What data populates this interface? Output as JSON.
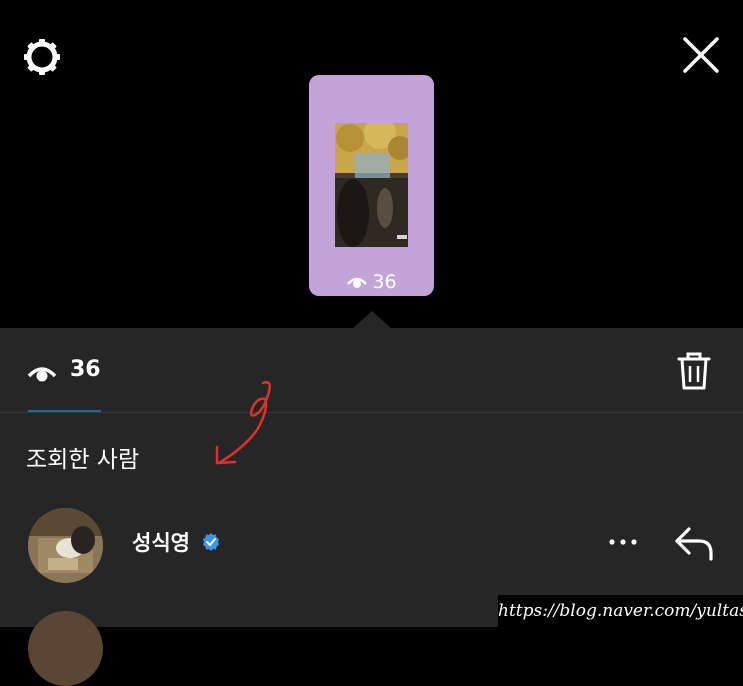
{
  "header": {
    "settings_icon": "gear-icon",
    "close_icon": "close-icon"
  },
  "story_preview": {
    "view_count": "36",
    "eye_icon": "eye-icon"
  },
  "stats": {
    "view_count": "36",
    "eye_icon": "eye-icon",
    "delete_icon": "trash-icon"
  },
  "viewers_section": {
    "title": "조회한 사람",
    "viewers": [
      {
        "name": "성식영",
        "verified": true,
        "more_icon": "more-horizontal-icon",
        "reply_icon": "reply-icon"
      }
    ]
  },
  "watermark": {
    "text": "https://blog.naver.com/yultas"
  },
  "colors": {
    "background_top": "#000000",
    "panel": "#262626",
    "story_card": "#c4a3d8",
    "verified": "#3897f0",
    "annotation": "#e0302a",
    "tab_underline": "#1f6f96"
  }
}
